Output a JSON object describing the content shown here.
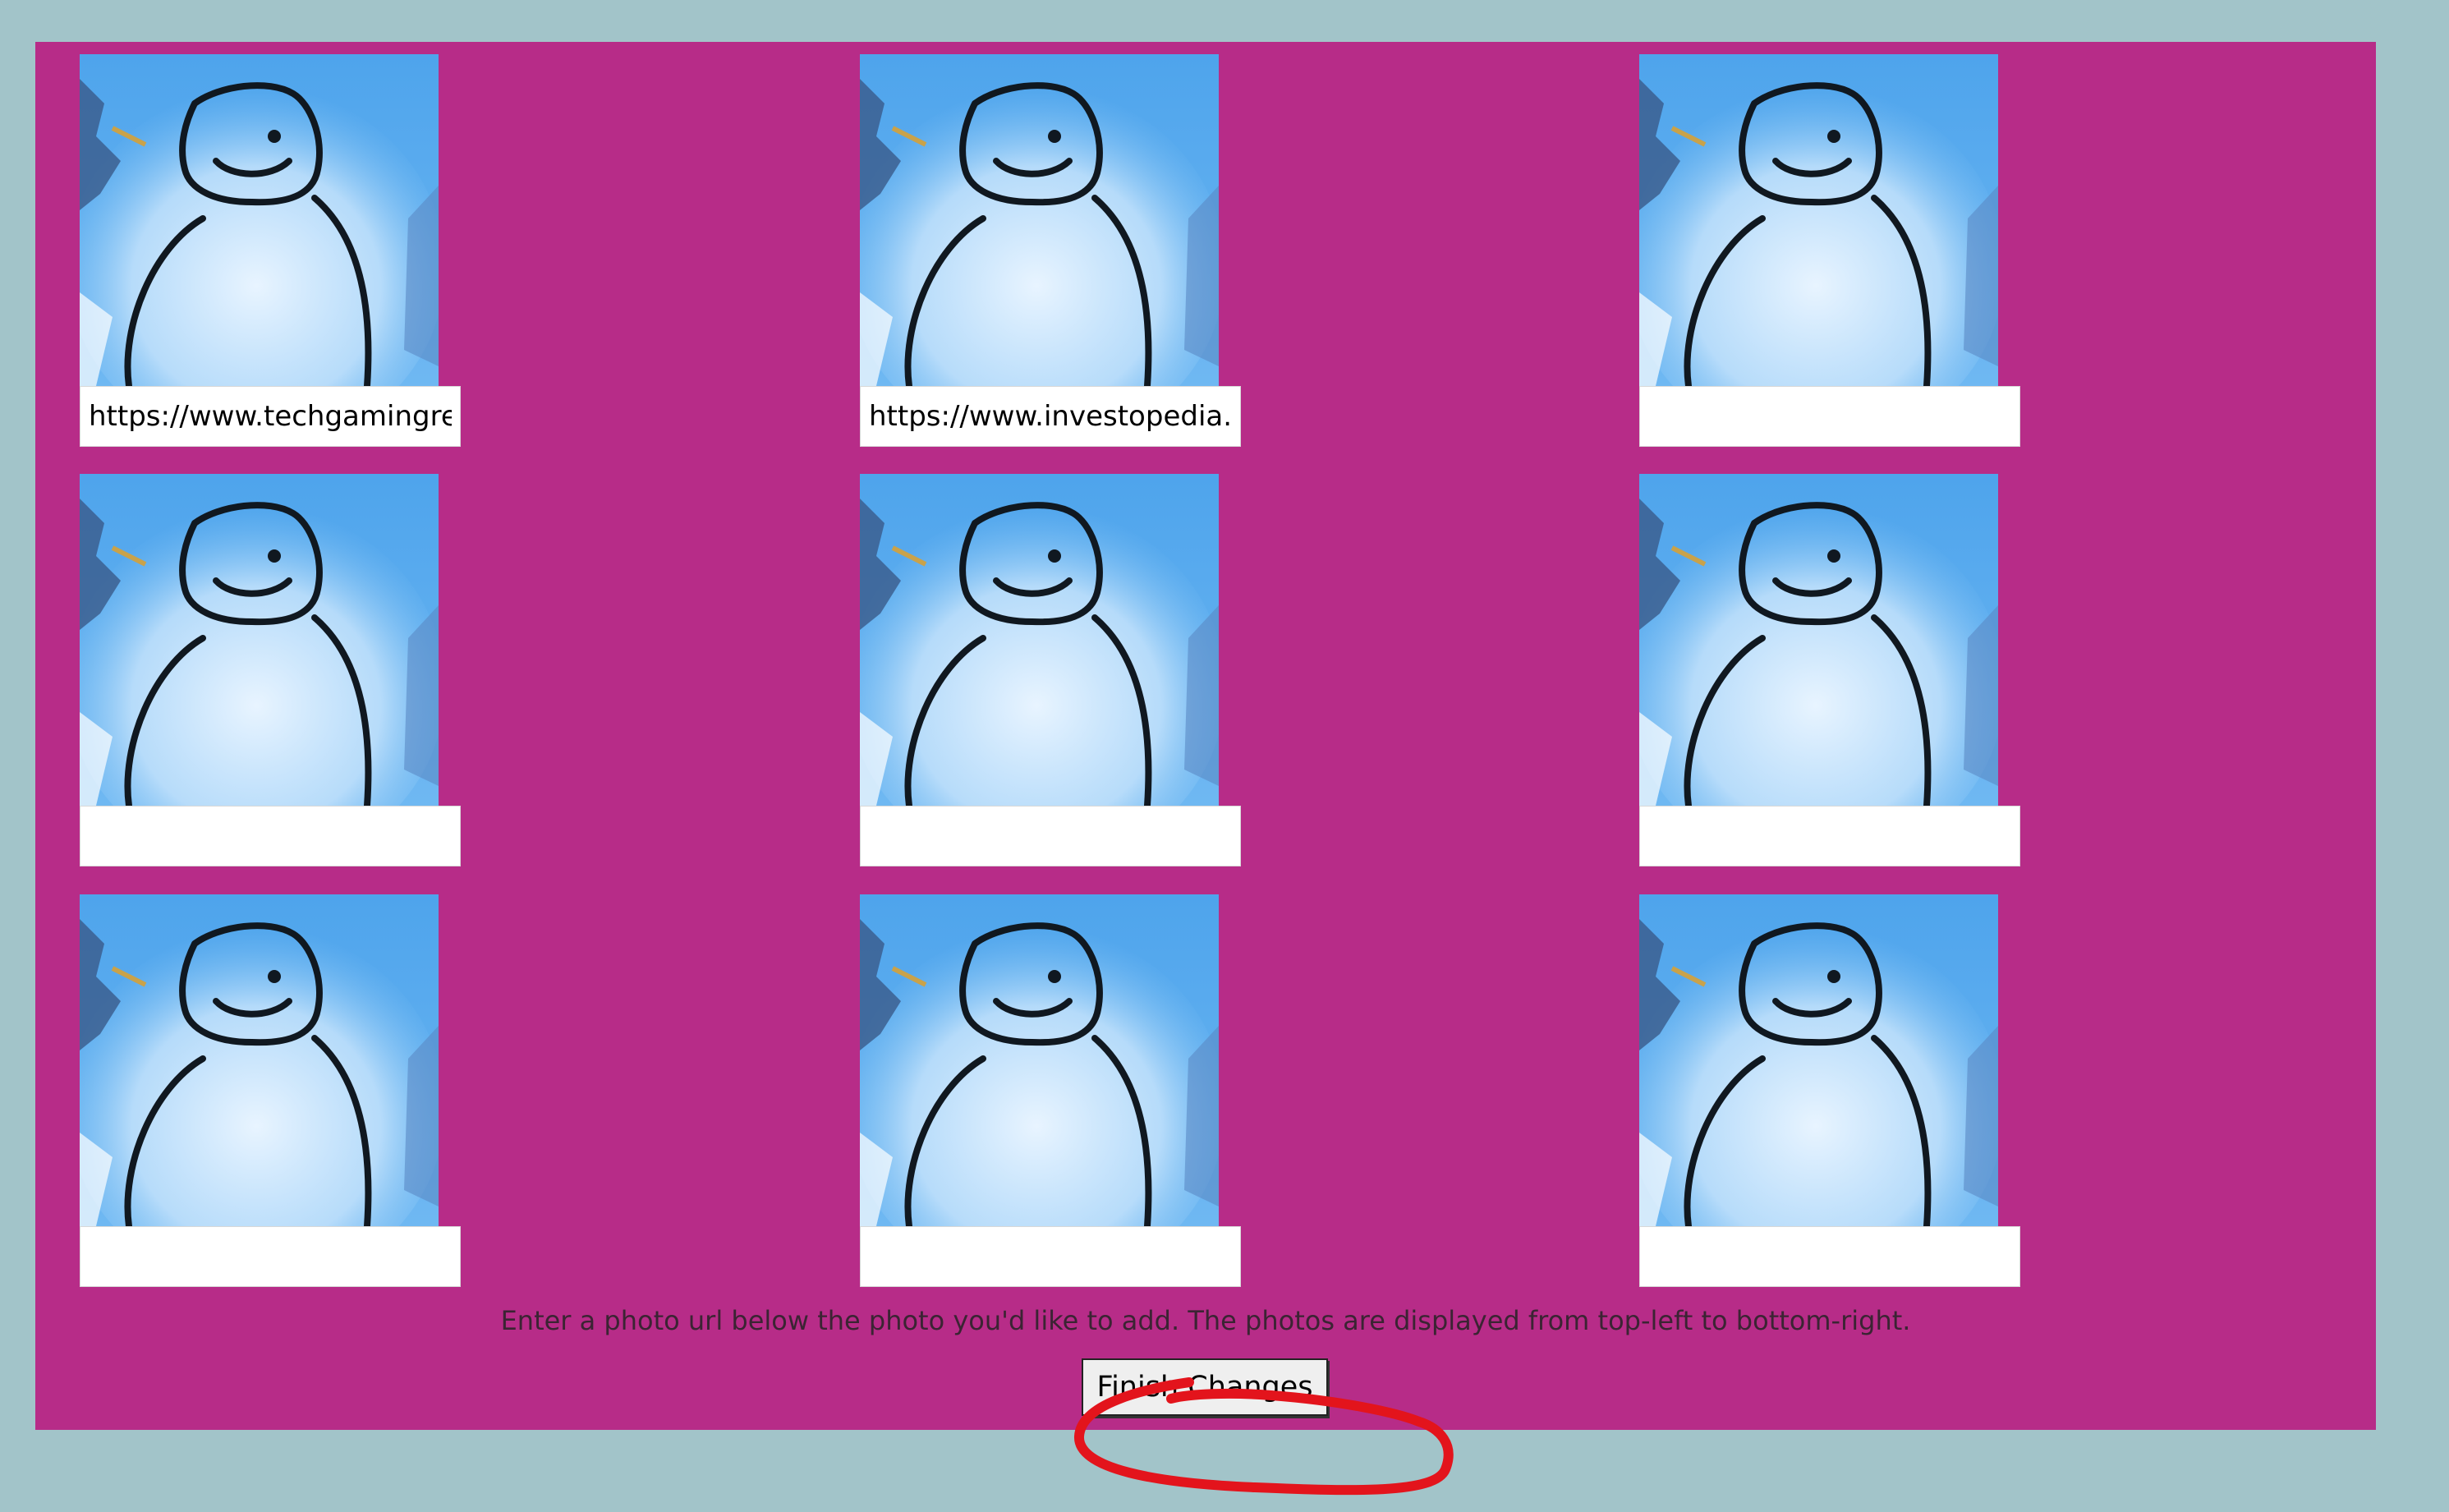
{
  "grid": {
    "tiles": [
      {
        "image_alt": "snowman drawing",
        "url_value": "https://www.techgamingreport.com/",
        "url_placeholder": ""
      },
      {
        "image_alt": "snowman drawing",
        "url_value": "https://www.investopedia.com/",
        "url_placeholder": ""
      },
      {
        "image_alt": "snowman drawing",
        "url_value": "",
        "url_placeholder": ""
      },
      {
        "image_alt": "snowman drawing",
        "url_value": "",
        "url_placeholder": ""
      },
      {
        "image_alt": "snowman drawing",
        "url_value": "",
        "url_placeholder": ""
      },
      {
        "image_alt": "snowman drawing",
        "url_value": "",
        "url_placeholder": ""
      },
      {
        "image_alt": "snowman drawing",
        "url_value": "",
        "url_placeholder": ""
      },
      {
        "image_alt": "snowman drawing",
        "url_value": "",
        "url_placeholder": ""
      },
      {
        "image_alt": "snowman drawing",
        "url_value": "",
        "url_placeholder": ""
      }
    ]
  },
  "instructions": "Enter a photo url below the photo you'd like to add. The photos are displayed from top-left to bottom-right.",
  "finish_button_label": "Finish Changes",
  "colors": {
    "page_background": "#a2c4c9",
    "panel_background": "#b72c88",
    "annotation_circle": "#e3141c",
    "photo_sky": "#4ea4ec"
  }
}
